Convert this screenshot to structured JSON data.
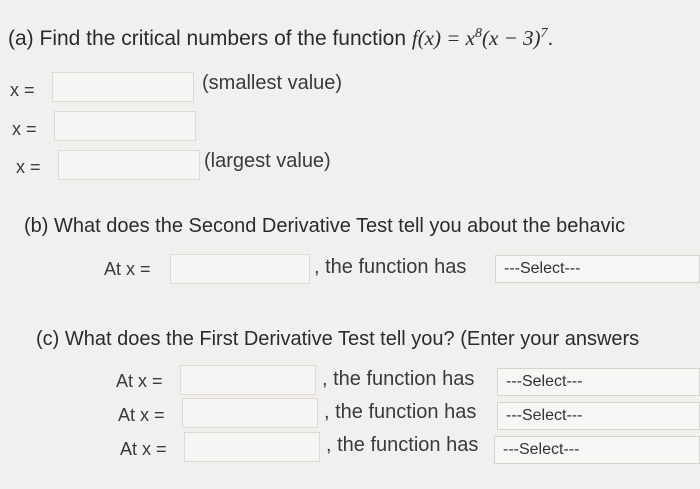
{
  "part_a": {
    "prefix": "(a) Find the critical numbers of the function ",
    "fn": "f(x) = x",
    "exp1": "8",
    "mid": "(x − 3)",
    "exp2": "7",
    "suffix": ".",
    "rows": [
      {
        "label": "x =",
        "value": "",
        "note": "(smallest value)"
      },
      {
        "label": "x =",
        "value": "",
        "note": ""
      },
      {
        "label": "x =",
        "value": "",
        "note": "(largest value)"
      }
    ]
  },
  "part_b": {
    "question": "(b) What does the Second Derivative Test tell you about the behavic",
    "row": {
      "label": "At x =",
      "value": "",
      "mid": ", the function has",
      "select": "---Select---"
    }
  },
  "part_c": {
    "question": "(c) What does the First Derivative Test tell you? (Enter your answers",
    "rows": [
      {
        "label": "At x =",
        "value": "",
        "mid": ", the function has",
        "select": "---Select---"
      },
      {
        "label": "At x =",
        "value": "",
        "mid": ", the function has",
        "select": "---Select---"
      },
      {
        "label": "At x =",
        "value": "",
        "mid": ", the function has",
        "select": "---Select---"
      }
    ]
  }
}
